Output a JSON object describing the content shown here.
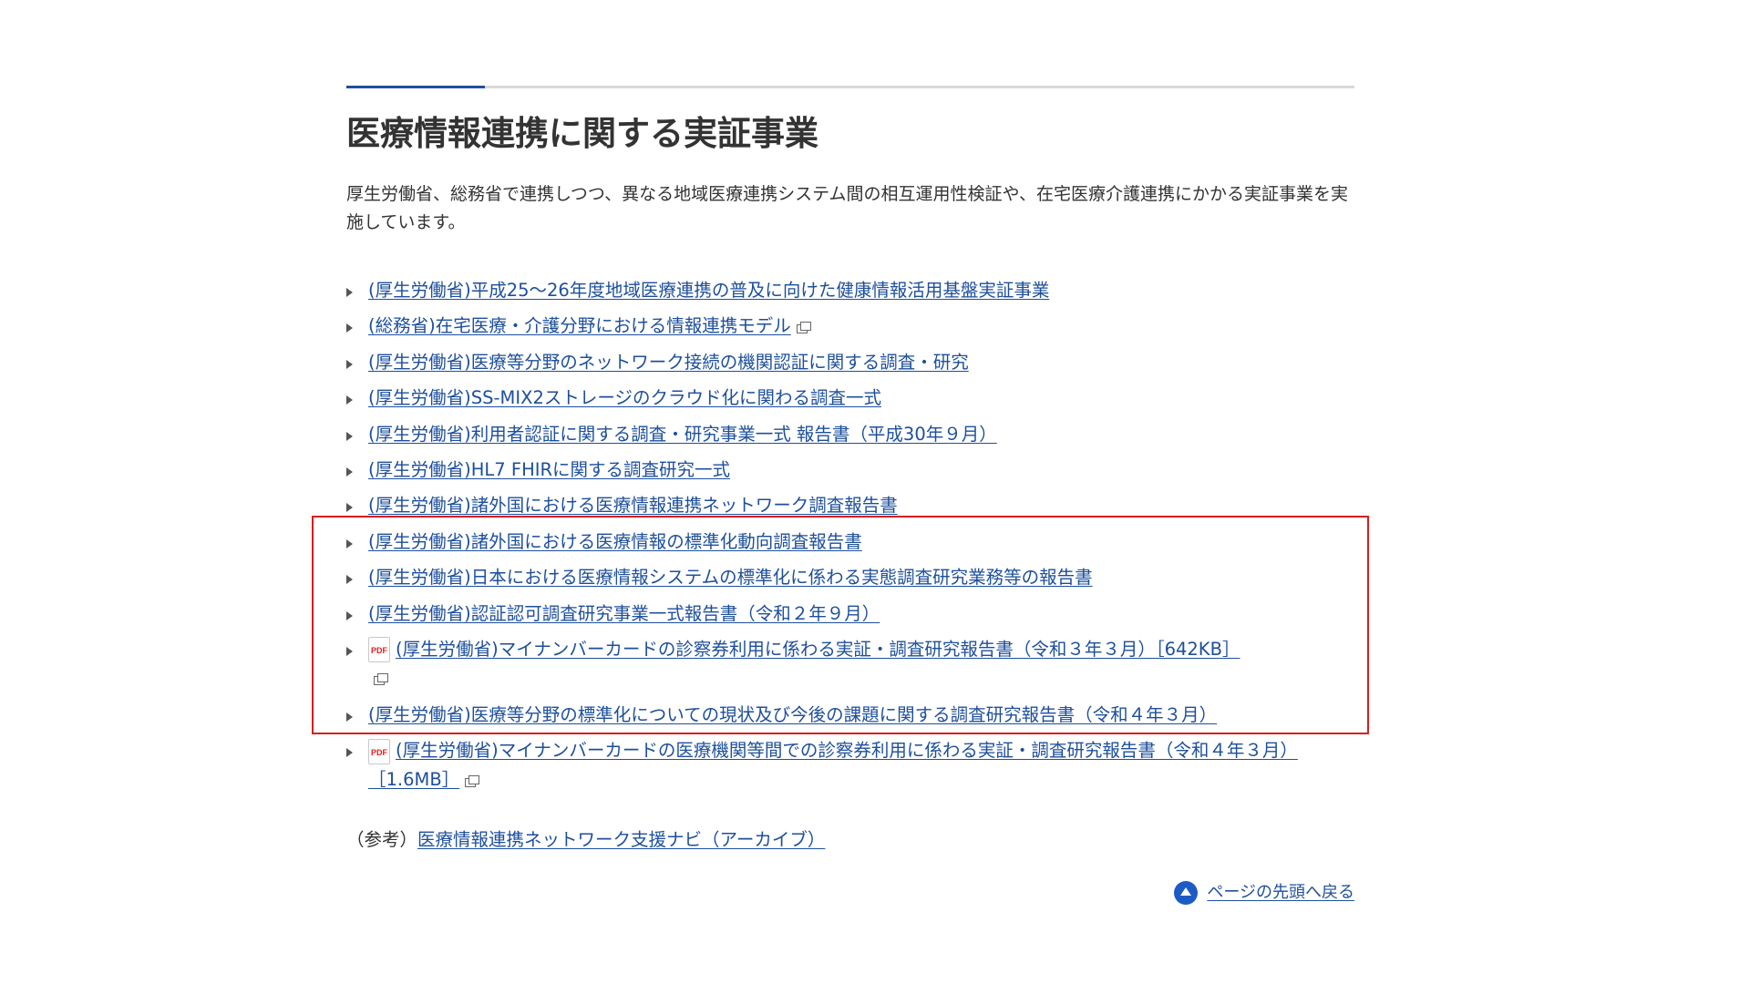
{
  "section": {
    "title": "医療情報連携に関する実証事業",
    "intro": "厚生労働省、総務省で連携しつつ、異なる地域医療連携システム間の相互運用性検証や、在宅医療介護連携にかかる実証事業を実施しています。"
  },
  "links": [
    {
      "label": "(厚生労働省)平成25～26年度地域医療連携の普及に向けた健康情報活用基盤実証事業",
      "pdf": false,
      "external": false
    },
    {
      "label": "(総務省)在宅医療・介護分野における情報連携モデル",
      "pdf": false,
      "external": true
    },
    {
      "label": "(厚生労働省)医療等分野のネットワーク接続の機関認証に関する調査・研究",
      "pdf": false,
      "external": false
    },
    {
      "label": "(厚生労働省)SS-MIX2ストレージのクラウド化に関わる調査一式",
      "pdf": false,
      "external": false
    },
    {
      "label": "(厚生労働省)利用者認証に関する調査・研究事業一式 報告書（平成30年９月）",
      "pdf": false,
      "external": false
    },
    {
      "label": "(厚生労働省)HL7 FHIRに関する調査研究一式",
      "pdf": false,
      "external": false
    },
    {
      "label": "(厚生労働省)諸外国における医療情報連携ネットワーク調査報告書",
      "pdf": false,
      "external": false
    },
    {
      "label": "(厚生労働省)諸外国における医療情報の標準化動向調査報告書",
      "pdf": false,
      "external": false
    },
    {
      "label": "(厚生労働省)日本における医療情報システムの標準化に係わる実態調査研究業務等の報告書",
      "pdf": false,
      "external": false
    },
    {
      "label": "(厚生労働省)認証認可調査研究事業一式報告書（令和２年９月）",
      "pdf": false,
      "external": false
    },
    {
      "label": "(厚生労働省)マイナンバーカードの診察券利用に係わる実証・調査研究報告書（令和３年３月）［642KB］",
      "pdf": true,
      "external": true
    },
    {
      "label": "(厚生労働省)医療等分野の標準化についての現状及び今後の課題に関する調査研究報告書（令和４年３月）",
      "pdf": false,
      "external": false
    },
    {
      "label": "(厚生労働省)マイナンバーカードの医療機関等間での診察券利用に係わる実証・調査研究報告書（令和４年３月）［1.6MB］",
      "pdf": true,
      "external": true
    }
  ],
  "reference": {
    "prefix": "（参考）",
    "link_label": "医療情報連携ネットワーク支援ナビ（アーカイブ）"
  },
  "back_to_top": {
    "label": "ページの先頭へ戻る"
  },
  "icons": {
    "pdf_label": "PDF"
  },
  "colors": {
    "link": "#1d4f9c",
    "highlight": "#d81e1e",
    "accent": "#1d5bc4"
  }
}
